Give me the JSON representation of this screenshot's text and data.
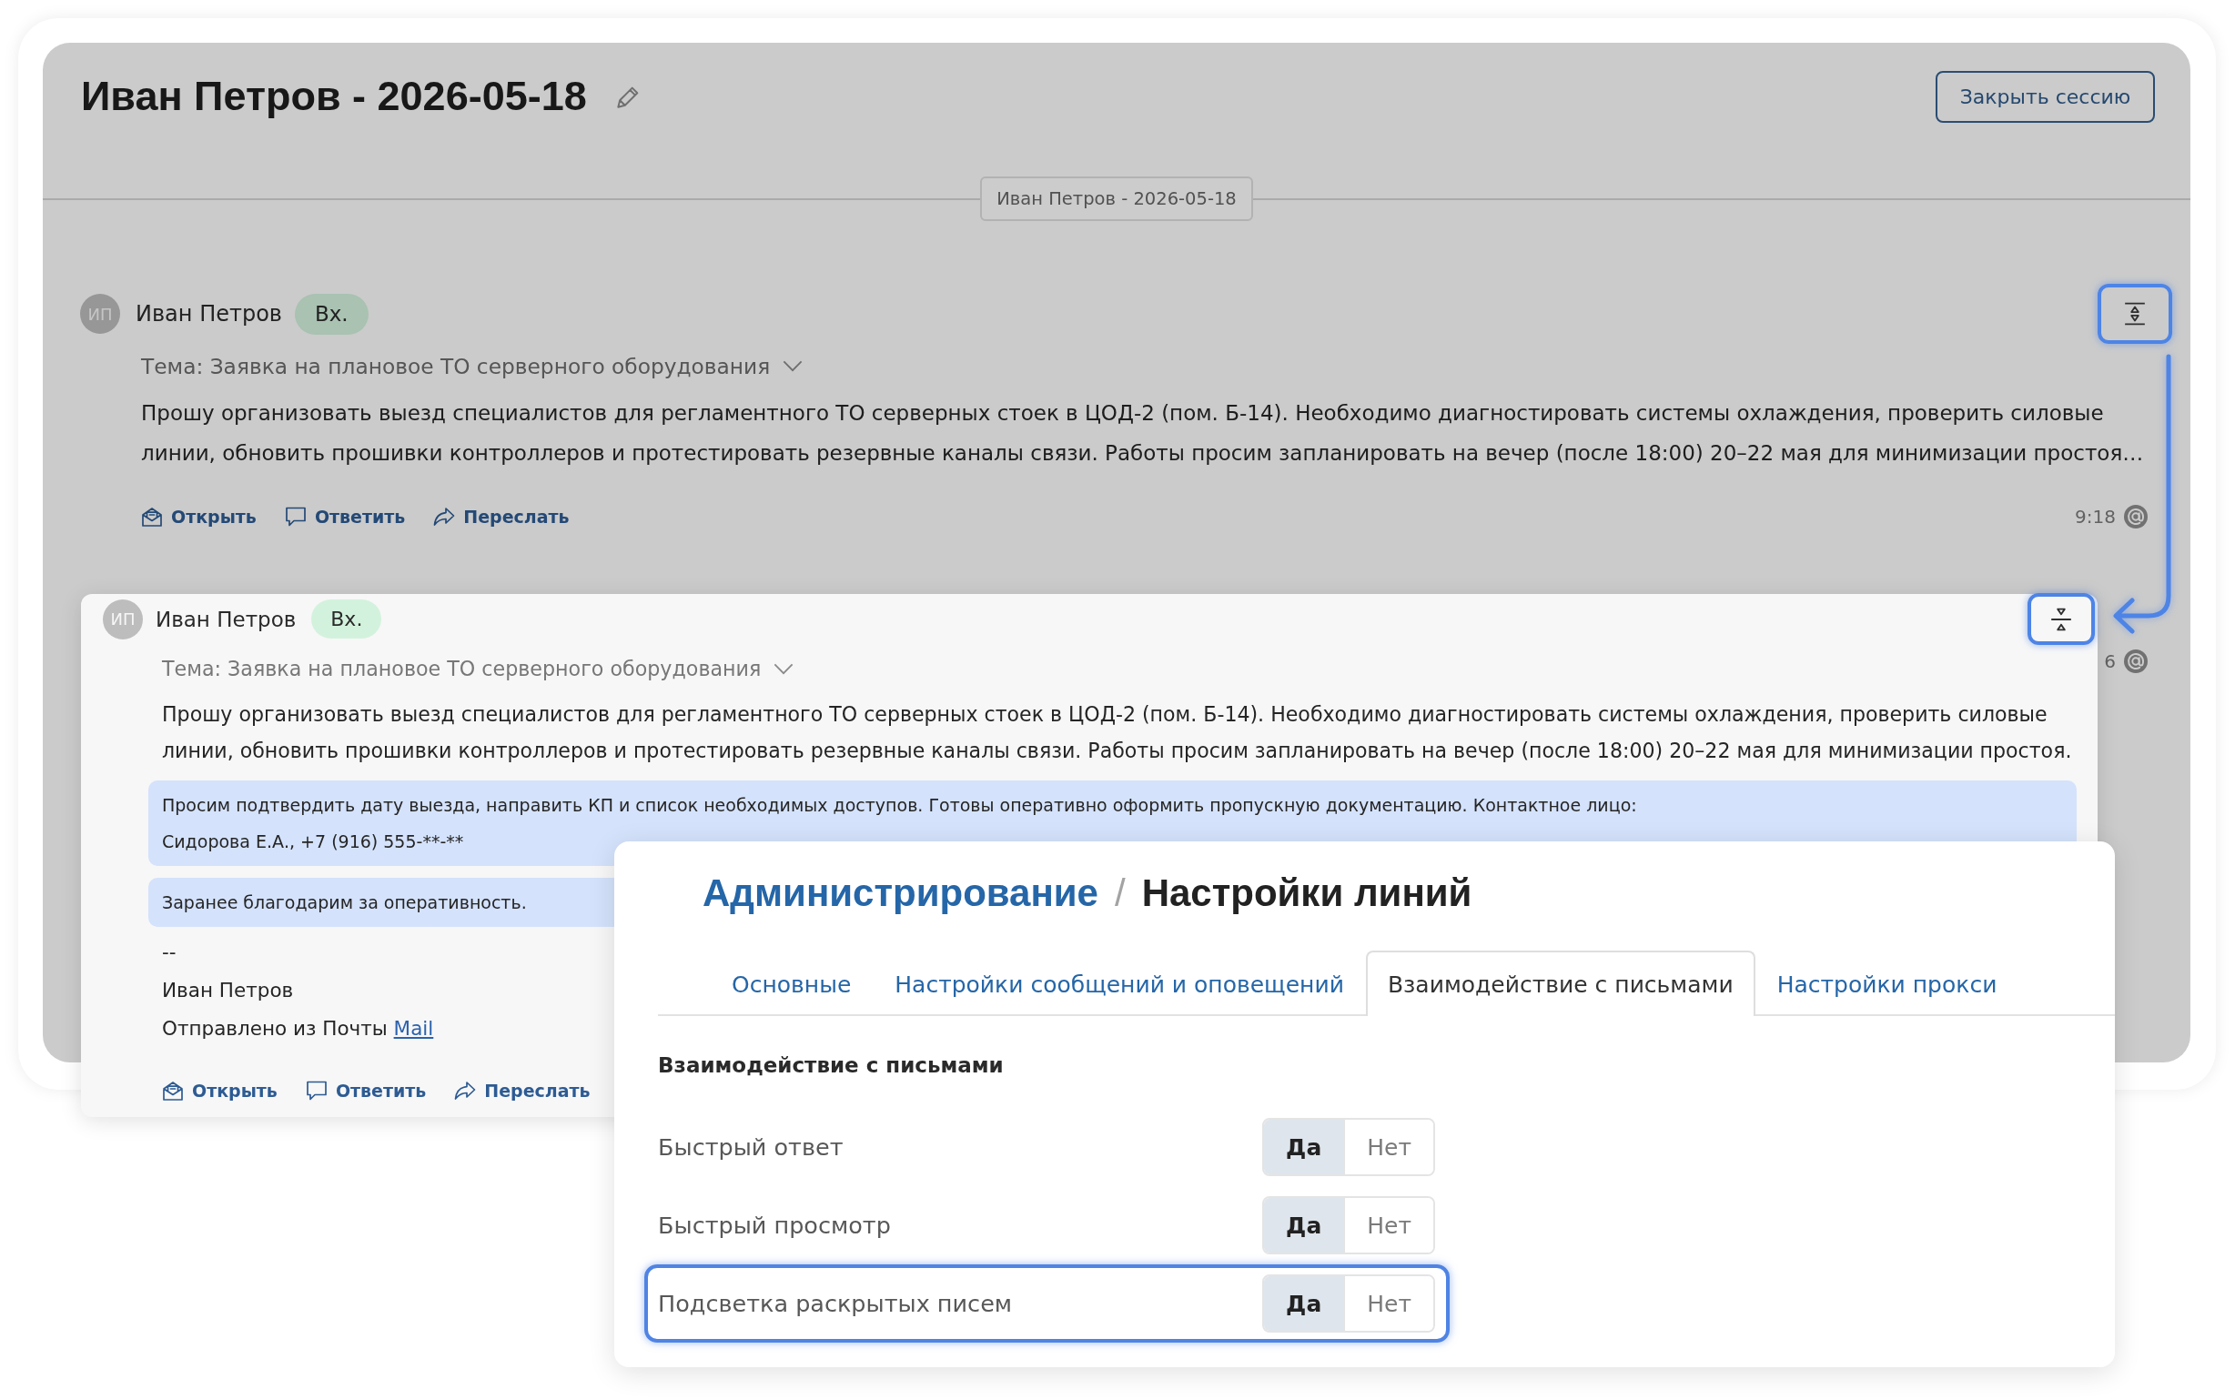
{
  "chat": {
    "title": "Иван Петров - 2026-05-18",
    "close_button": "Закрыть сессию",
    "date_divider": "Иван Петров - 2026-05-18",
    "dimmed": true,
    "messages": [
      {
        "avatar": "ИП",
        "sender": "Иван Петров",
        "badge": "Вх.",
        "expanded": false,
        "toggle": {
          "highlighted": true
        },
        "subject": "Тема: Заявка на плановое ТО серверного оборудования",
        "body": "Прошу организовать выезд специалистов для регламентного ТО серверных стоек в ЦОД-2 (пом. Б-14). Необходимо диагностировать системы охлаждения, проверить силовые линии, обновить прошивки контроллеров и протестировать резервные каналы связи. Работы просим запланировать на вечер (после 18:00) 20–22 мая для минимизации простоя…",
        "actions": [
          {
            "kind": "open",
            "label": "Открыть"
          },
          {
            "kind": "reply",
            "label": "Ответить"
          },
          {
            "kind": "forward",
            "label": "Переслать"
          }
        ],
        "time": "9:18"
      },
      {
        "time": "6"
      }
    ]
  },
  "expanded_message": {
    "avatar": "ИП",
    "sender": "Иван Петров",
    "badge": "Вх.",
    "expanded": true,
    "toggle": {
      "highlighted": true
    },
    "subject": "Тема: Заявка на плановое ТО серверного оборудования",
    "paragraphs": [
      {
        "text": "Прошу организовать выезд специалистов для регламентного ТО серверных стоек в ЦОД-2 (пом. Б-14). Необходимо диагностировать системы охлаждения, проверить силовые линии, обновить прошивки контроллеров и протестировать резервные каналы связи. Работы просим запланировать на вечер (после 18:00) 20–22 мая для минимизации простоя.",
        "highlighted": false
      },
      {
        "text": "Просим подтвердить дату выезда, направить КП и список необходимых доступов. Готовы оперативно оформить пропускную документацию. Контактное лицо:\nСидорова Е.А., +7 (916) 555-**-**",
        "highlighted": true
      },
      {
        "text": "Заранее благодарим за оперативность.",
        "highlighted": true
      }
    ],
    "signature": [
      {
        "text": "--"
      },
      {
        "text": "Иван Петров"
      },
      {
        "text": "Отправлено из Почты",
        "link": "Mail"
      }
    ],
    "actions": [
      {
        "kind": "open",
        "label": "Открыть"
      },
      {
        "kind": "reply",
        "label": "Ответить"
      },
      {
        "kind": "forward",
        "label": "Переслать"
      }
    ]
  },
  "settings": {
    "breadcrumb": [
      {
        "label": "Администрирование",
        "link": true
      },
      {
        "label": "Настройки линий",
        "link": false
      }
    ],
    "separator": "/",
    "tabs": [
      {
        "label": "Основные",
        "selected": false
      },
      {
        "label": "Настройки сообщений и оповещений",
        "selected": false
      },
      {
        "label": "Взаимодействие с письмами",
        "selected": true
      },
      {
        "label": "Настройки прокси",
        "selected": false
      }
    ],
    "section_title": "Взаимодействие с письмами",
    "rows": [
      {
        "label": "Быстрый ответ",
        "highlighted": false,
        "options": [
          {
            "label": "Да",
            "selected": true
          },
          {
            "label": "Нет",
            "selected": false
          }
        ]
      },
      {
        "label": "Быстрый просмотр",
        "highlighted": false,
        "options": [
          {
            "label": "Да",
            "selected": true
          },
          {
            "label": "Нет",
            "selected": false
          }
        ]
      },
      {
        "label": "Подсветка раскрытых писем",
        "highlighted": true,
        "options": [
          {
            "label": "Да",
            "selected": true
          },
          {
            "label": "Нет",
            "selected": false
          }
        ]
      }
    ]
  }
}
